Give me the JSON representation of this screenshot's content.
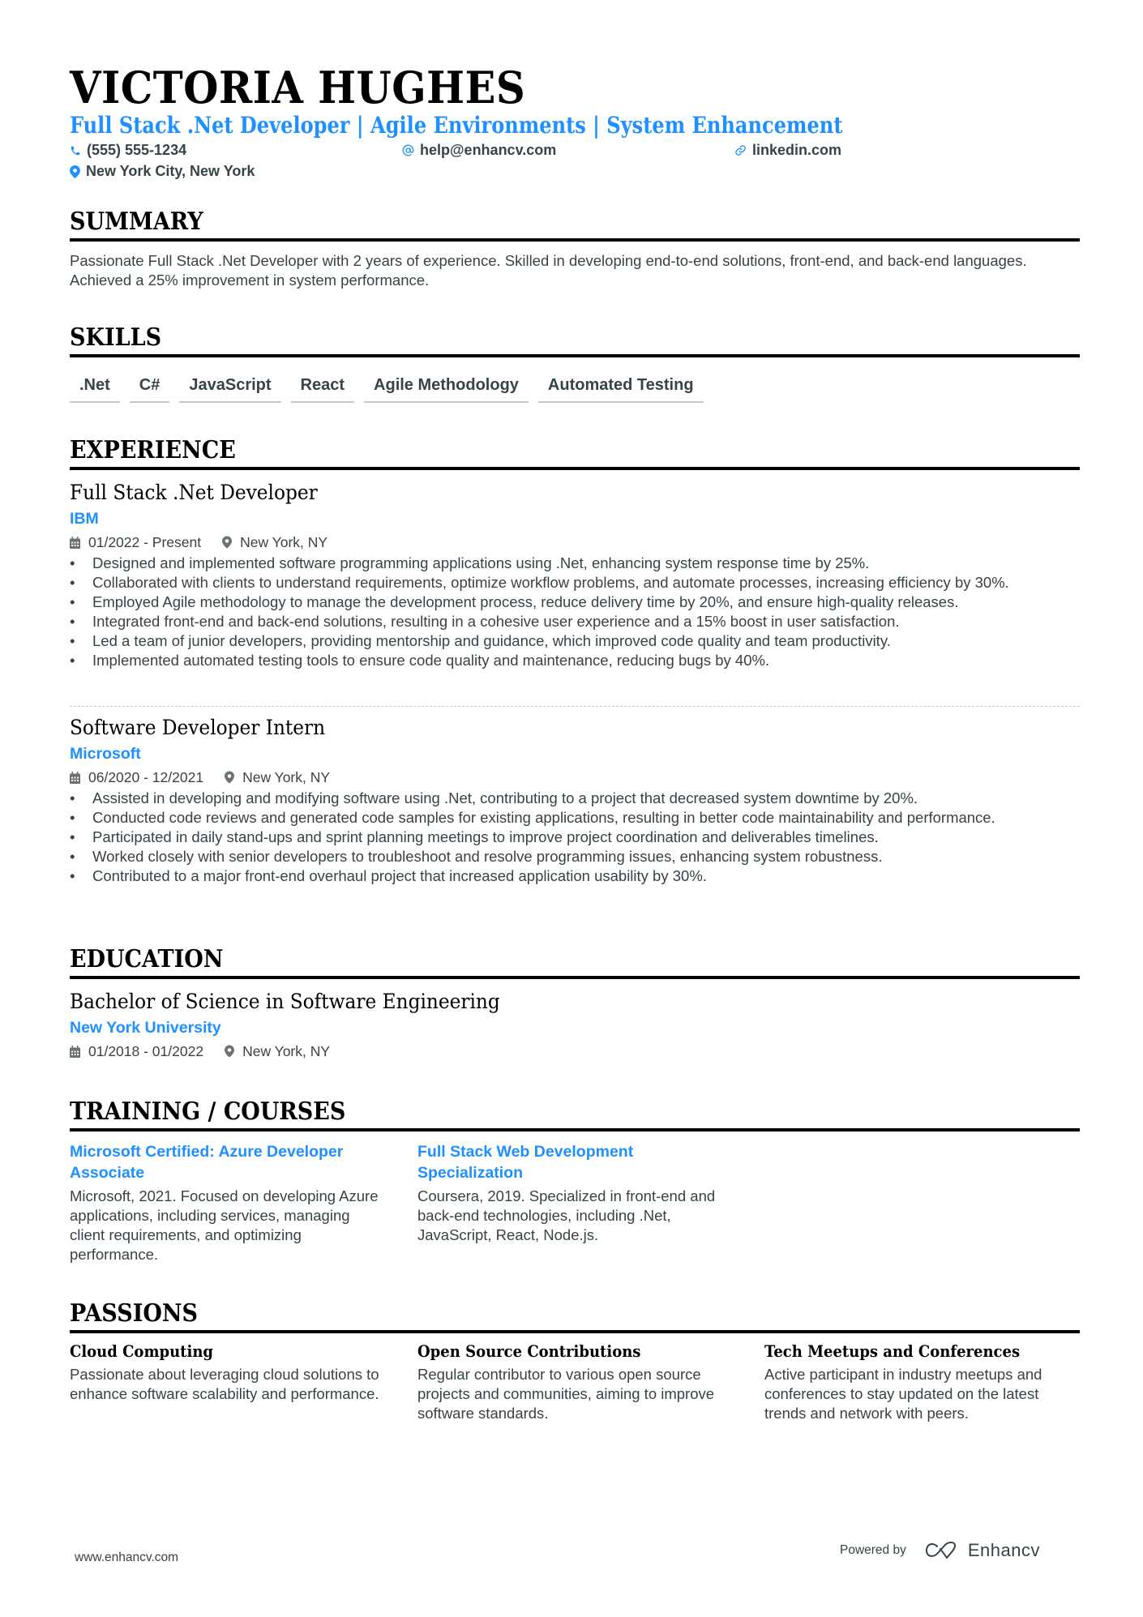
{
  "header": {
    "name": "VICTORIA HUGHES",
    "title": "Full Stack .Net Developer | Agile Environments | System Enhancement",
    "contact": {
      "phone": "(555) 555-1234",
      "email": "help@enhancv.com",
      "link": "linkedin.com",
      "location": "New York City, New York"
    }
  },
  "summary": {
    "heading": "SUMMARY",
    "text": "Passionate Full Stack .Net Developer with 2 years of experience. Skilled in developing end-to-end solutions, front-end, and back-end languages. Achieved a 25% improvement in system performance."
  },
  "skills": {
    "heading": "SKILLS",
    "items": [
      ".Net",
      "C#",
      "JavaScript",
      "React",
      "Agile Methodology",
      "Automated Testing"
    ]
  },
  "experience": {
    "heading": "EXPERIENCE",
    "jobs": [
      {
        "title": "Full Stack .Net Developer",
        "company": "IBM",
        "dates": "01/2022 - Present",
        "location": "New York, NY",
        "bullets": [
          "Designed and implemented software programming applications using .Net, enhancing system response time by 25%.",
          "Collaborated with clients to understand requirements, optimize workflow problems, and automate processes, increasing efficiency by 30%.",
          "Employed Agile methodology to manage the development process, reduce delivery time by 20%, and ensure high-quality releases.",
          "Integrated front-end and back-end solutions, resulting in a cohesive user experience and a 15% boost in user satisfaction.",
          "Led a team of junior developers, providing mentorship and guidance, which improved code quality and team productivity.",
          "Implemented automated testing tools to ensure code quality and maintenance, reducing bugs by 40%."
        ]
      },
      {
        "title": "Software Developer Intern",
        "company": "Microsoft",
        "dates": "06/2020 - 12/2021",
        "location": "New York, NY",
        "bullets": [
          "Assisted in developing and modifying software using .Net, contributing to a project that decreased system downtime by 20%.",
          "Conducted code reviews and generated code samples for existing applications, resulting in better code maintainability and performance.",
          "Participated in daily stand-ups and sprint planning meetings to improve project coordination and deliverables timelines.",
          "Worked closely with senior developers to troubleshoot and resolve programming issues, enhancing system robustness.",
          "Contributed to a major front-end overhaul project that increased application usability by 30%."
        ]
      }
    ]
  },
  "education": {
    "heading": "EDUCATION",
    "degree": "Bachelor of Science in Software Engineering",
    "school": "New York University",
    "dates": "01/2018 - 01/2022",
    "location": "New York, NY"
  },
  "training": {
    "heading": "TRAINING / COURSES",
    "items": [
      {
        "title": "Microsoft Certified: Azure Developer Associate",
        "description": "Microsoft, 2021. Focused on developing Azure applications, including services, managing client requirements, and optimizing performance."
      },
      {
        "title": "Full Stack Web Development Specialization",
        "description": "Coursera, 2019. Specialized in front-end and back-end technologies, including .Net, JavaScript, React, Node.js."
      }
    ]
  },
  "passions": {
    "heading": "PASSIONS",
    "items": [
      {
        "title": "Cloud Computing",
        "description": "Passionate about leveraging cloud solutions to enhance software scalability and performance."
      },
      {
        "title": "Open Source Contributions",
        "description": "Regular contributor to various open source projects and communities, aiming to improve software standards."
      },
      {
        "title": "Tech Meetups and Conferences",
        "description": "Active participant in industry meetups and conferences to stay updated on the latest trends and network with peers."
      }
    ]
  },
  "footer": {
    "website": "www.enhancv.com",
    "powered_by": "Powered by",
    "brand": "Enhancv"
  },
  "icons": {
    "phone": "phone-icon",
    "email": "at-icon",
    "link": "link-icon",
    "location": "map-pin-icon",
    "calendar": "calendar-icon",
    "logo": "enhancv-logo-icon"
  },
  "colors": {
    "accent": "#1e90ff",
    "text": "#384347",
    "heading": "#000000",
    "divider": "#c7c9cb"
  }
}
